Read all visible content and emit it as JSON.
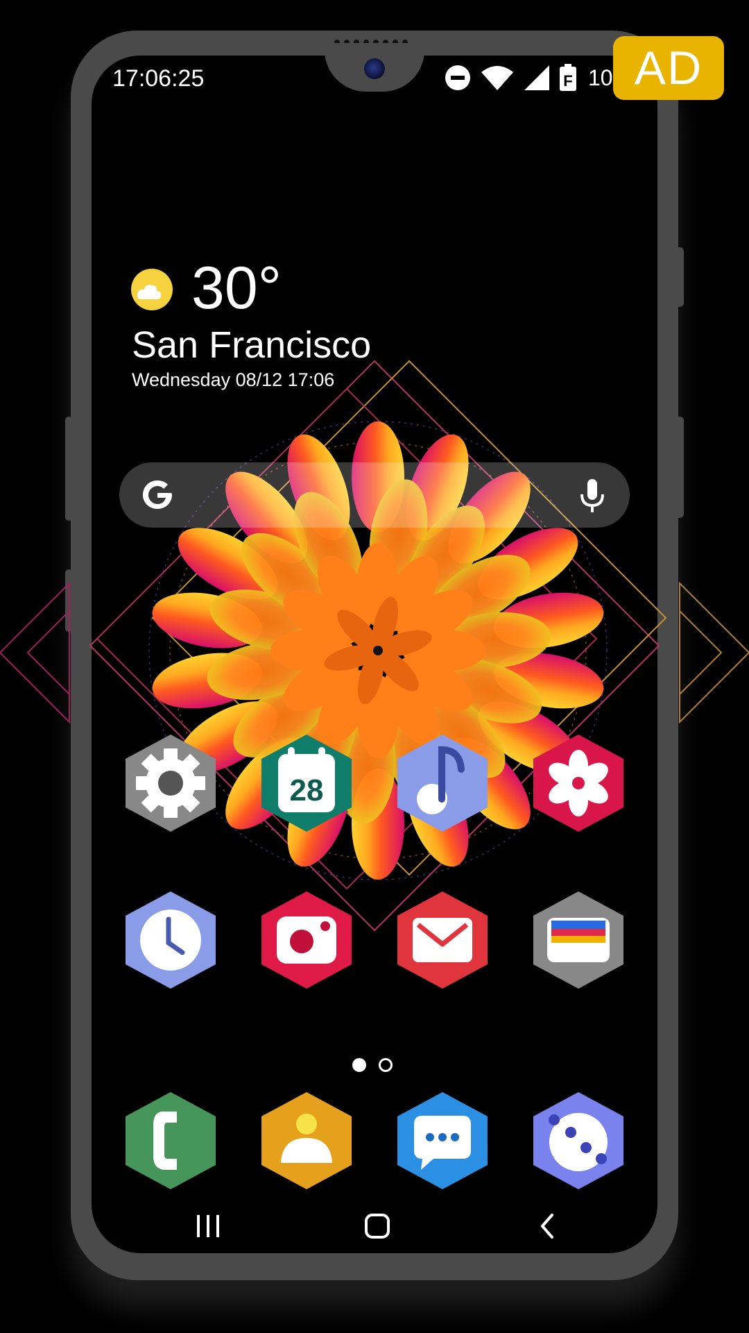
{
  "status_bar": {
    "time": "17:06:25",
    "battery_text": "100",
    "icons": [
      "do-not-disturb-icon",
      "wifi-icon",
      "cell-signal-icon",
      "battery-icon"
    ]
  },
  "ad_badge": {
    "label": "AD",
    "color": "#e8b400"
  },
  "weather": {
    "temperature": "30°",
    "city": "San Francisco",
    "date_time": "Wednesday 08/12 17:06",
    "icon": "partly-sunny-icon"
  },
  "search_bar": {
    "logo": "google-g-icon",
    "mic": "mic-icon"
  },
  "home_grid": {
    "row1": [
      {
        "icon": "settings-icon",
        "color": "#8a8a8a"
      },
      {
        "icon": "calendar-icon",
        "color": "#0f7d6a",
        "badge": "28"
      },
      {
        "icon": "music-icon",
        "color": "#8a9ce8"
      },
      {
        "icon": "gallery-flower-icon",
        "color": "#d8164a"
      }
    ],
    "row2": [
      {
        "icon": "clock-icon",
        "color": "#8a9ce8"
      },
      {
        "icon": "camera-icon",
        "color": "#e01a46"
      },
      {
        "icon": "email-icon",
        "color": "#e0353d"
      },
      {
        "icon": "wallet-icon",
        "color": "#8a8a8a"
      }
    ]
  },
  "page_indicator": {
    "current": 1,
    "total": 2
  },
  "dock": [
    {
      "icon": "phone-icon",
      "color": "#46955a"
    },
    {
      "icon": "contacts-icon",
      "color": "#e6a11c"
    },
    {
      "icon": "messages-icon",
      "color": "#2b8fe4"
    },
    {
      "icon": "galaxy-apps-icon",
      "color": "#7a82ee"
    }
  ],
  "nav_bar": [
    "recents-icon",
    "home-icon",
    "back-icon"
  ]
}
